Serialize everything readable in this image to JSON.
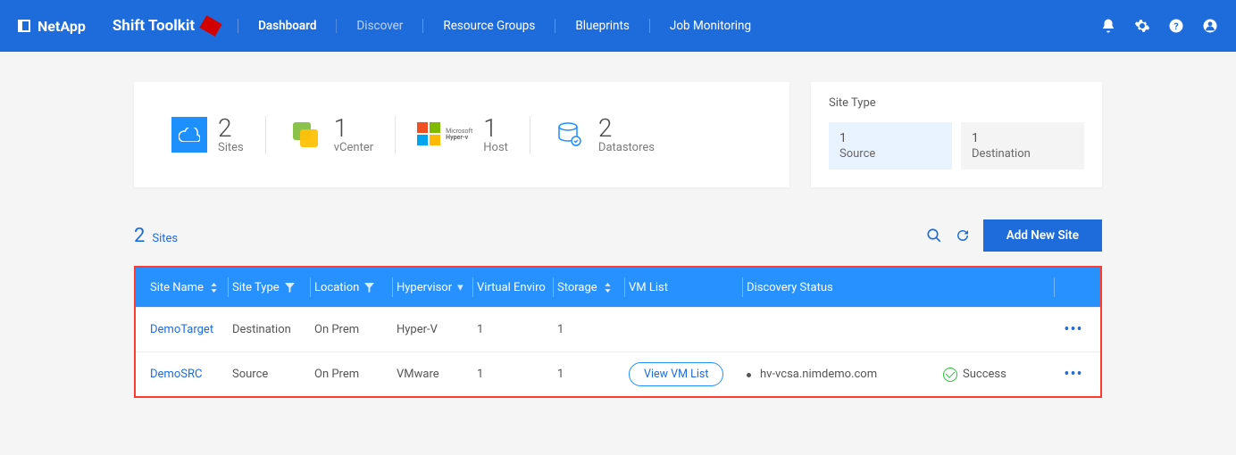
{
  "header": {
    "brand": "NetApp",
    "app_title": "Shift Toolkit",
    "nav": [
      "Dashboard",
      "Discover",
      "Resource Groups",
      "Blueprints",
      "Job Monitoring"
    ]
  },
  "stats": [
    {
      "value": "2",
      "label": "Sites"
    },
    {
      "value": "1",
      "label": "vCenter"
    },
    {
      "value": "1",
      "label": "Host"
    },
    {
      "value": "2",
      "label": "Datastores"
    }
  ],
  "site_type": {
    "title": "Site Type",
    "source": {
      "value": "1",
      "label": "Source"
    },
    "destination": {
      "value": "1",
      "label": "Destination"
    }
  },
  "sites_section": {
    "count": "2",
    "label": "Sites",
    "add_btn": "Add New Site"
  },
  "table": {
    "headers": {
      "site_name": "Site Name",
      "site_type": "Site Type",
      "location": "Location",
      "hypervisor": "Hypervisor",
      "virtual_env": "Virtual Environ",
      "storage": "Storage",
      "vm_list": "VM List",
      "discovery": "Discovery Status"
    },
    "rows": [
      {
        "site_name": "DemoTarget",
        "site_type": "Destination",
        "location": "On Prem",
        "hypervisor": "Hyper-V",
        "virtual_env": "1",
        "storage": "1",
        "vm_list_btn": "",
        "discovery": "",
        "status": ""
      },
      {
        "site_name": "DemoSRC",
        "site_type": "Source",
        "location": "On Prem",
        "hypervisor": "VMware",
        "virtual_env": "1",
        "storage": "1",
        "vm_list_btn": "View VM List",
        "discovery": "hv-vcsa.nimdemo.com",
        "status": "Success"
      }
    ]
  }
}
